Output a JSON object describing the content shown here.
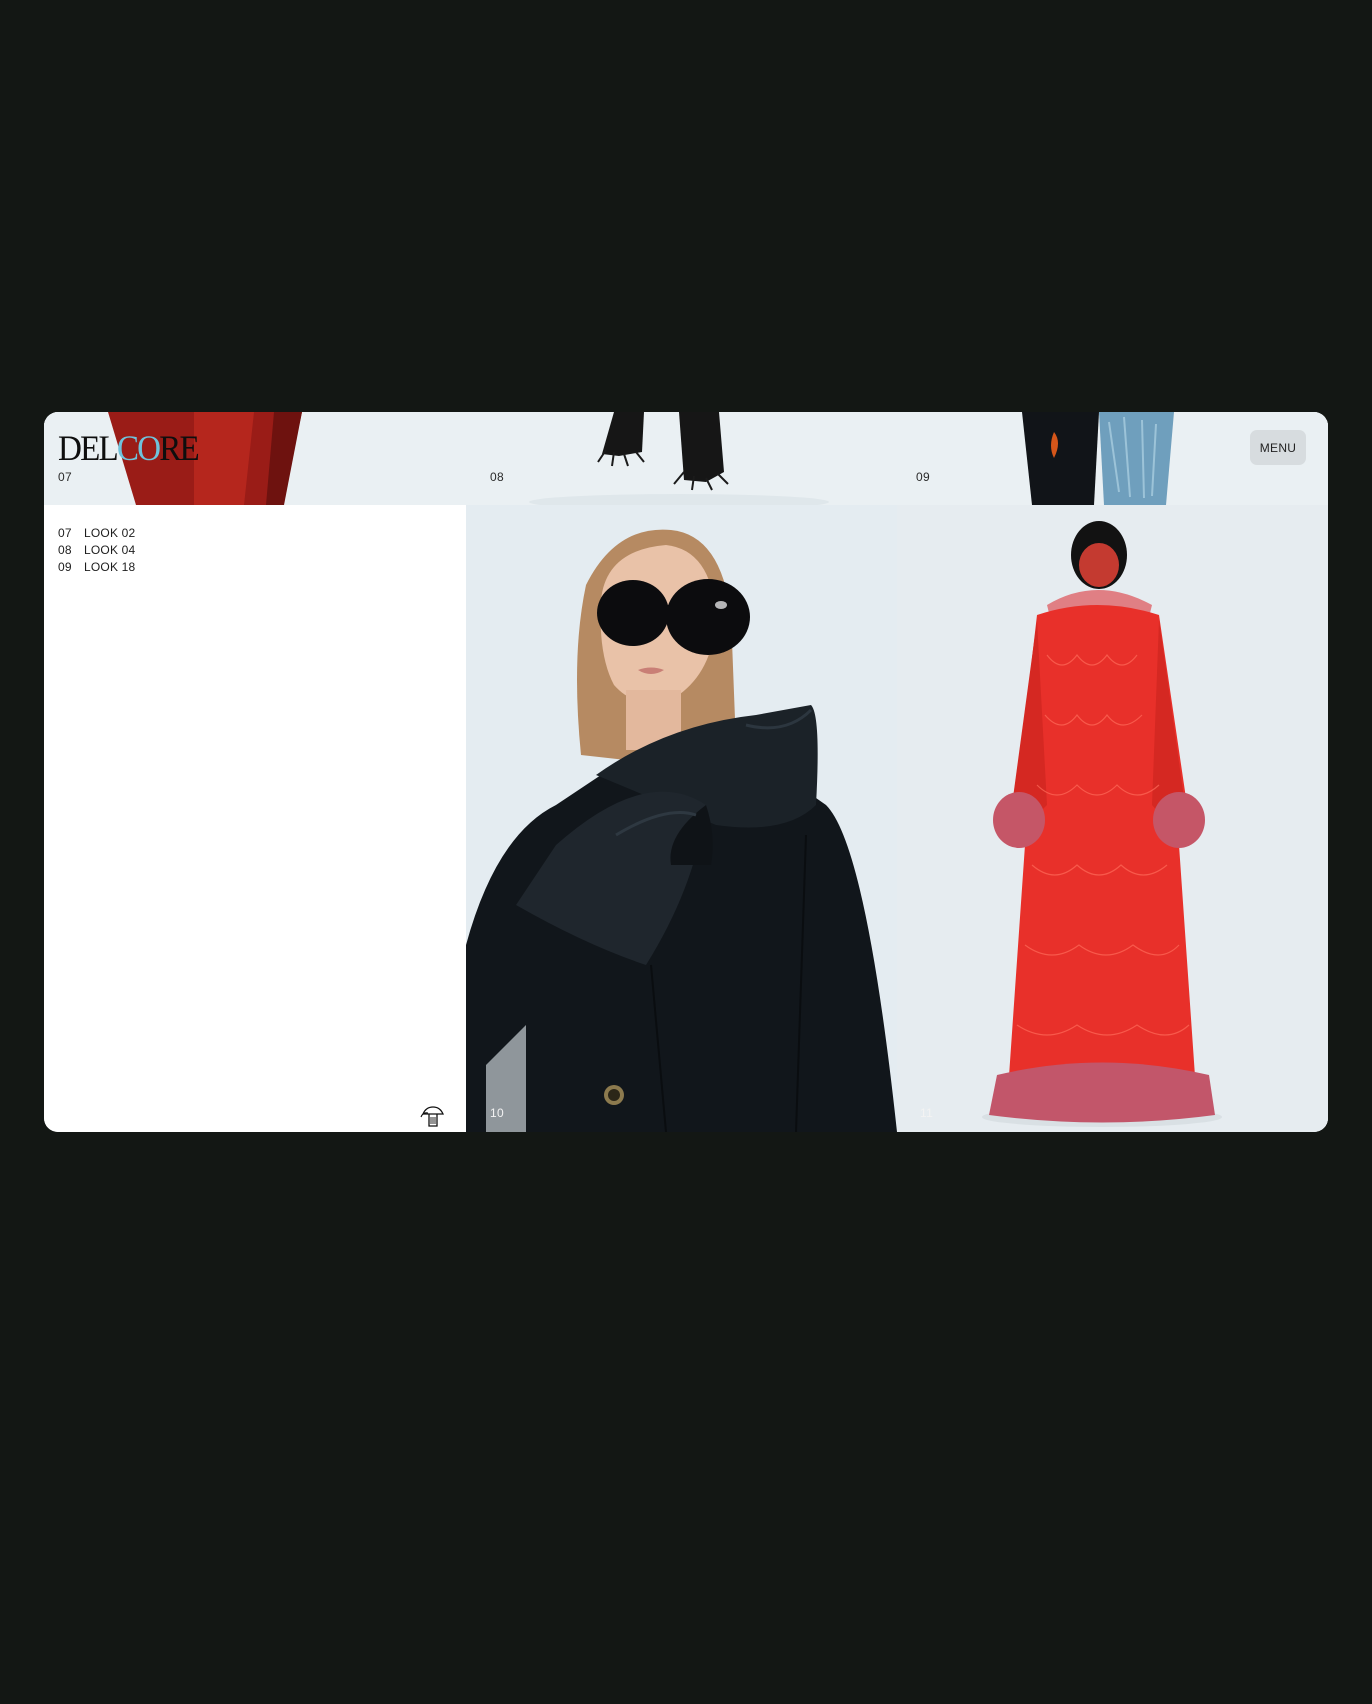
{
  "brand": {
    "logo_left": "DEL",
    "logo_o": "CO",
    "logo_right": "RE"
  },
  "header": {
    "menu_label": "MENU"
  },
  "strip": [
    {
      "num": "07"
    },
    {
      "num": "08"
    },
    {
      "num": "09"
    }
  ],
  "looks": [
    {
      "num": "07",
      "label": "LOOK 02"
    },
    {
      "num": "08",
      "label": "LOOK 04"
    },
    {
      "num": "09",
      "label": "LOOK 18"
    }
  ],
  "photos": [
    {
      "num": "10"
    },
    {
      "num": "11"
    }
  ],
  "colors": {
    "page_bg": "#131714",
    "accent_logo": "#6fc3dc",
    "menu_bg": "#d7dcdf"
  }
}
